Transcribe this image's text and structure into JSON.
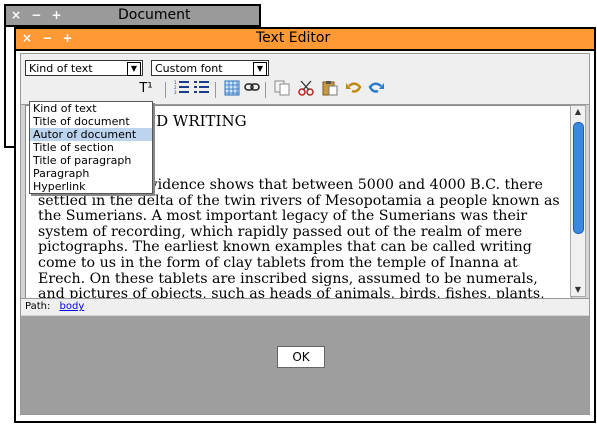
{
  "doc_window": {
    "title": "Document",
    "controls": "× − +"
  },
  "editor_window": {
    "title": "Text Editor",
    "controls": "× − +"
  },
  "toolbar": {
    "kind_select": "Kind of text",
    "font_select": "Custom font",
    "buttons": {
      "superscript": "T¹",
      "ordered_list": "ordered-list-icon",
      "unordered_list": "unordered-list-icon",
      "table": "table-icon",
      "link": "link-icon",
      "copy": "copy-icon",
      "cut": "scissors-icon",
      "paste": "paste-icon",
      "undo": "undo-icon",
      "redo": "redo-icon"
    }
  },
  "dropdown": {
    "options": [
      "Kind of text",
      "Title of document",
      "Autor of document",
      "Title of section",
      "Title of paragraph",
      "Paragraph",
      "Hyperlink"
    ],
    "selected": "Autor of document"
  },
  "content": {
    "heading": "ND WRITING",
    "paragraph": "Archeological evidence shows that between 5000 and 4000 B.C. there settled in the delta of the twin rivers of Mesopotamia a people known as the Sumerians. A most important legacy of the Sumerians was their system of recording, which rapidly passed out of the realm of mere pictographs. The earliest known examples that can be called writing come to us in the form of clay tablets from the temple of Inanna at Erech. On these tablets are inscribed signs, assumed to be numerals, and pictures of objects, such as heads of animals, birds, fishes, plants, domestic utensils, and parts of the human body. Hence it is safe to"
  },
  "pathbar": {
    "label": "Path:",
    "link": "body"
  },
  "ok_button": "OK",
  "colors": {
    "editor_title": "#ff9933",
    "doc_title": "#9a9a9a",
    "scroll_thumb": "#3a88e0"
  }
}
